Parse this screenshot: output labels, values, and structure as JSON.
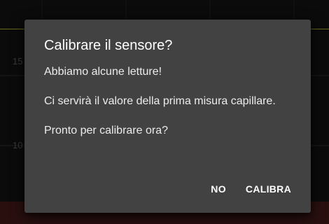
{
  "background": {
    "axis_labels": [
      "15",
      "10"
    ],
    "colors": {
      "background": "#0b0b0b",
      "target_line": "#6d6a1a",
      "low_band": "#2a0f0f"
    }
  },
  "dialog": {
    "title": "Calibrare il sensore?",
    "paragraphs": [
      "Abbiamo alcune letture!",
      "Ci servirà il valore della prima misura capillare.",
      "Pronto per calibrare ora?"
    ],
    "buttons": {
      "negative": "NO",
      "positive": "CALIBRA"
    },
    "colors": {
      "surface": "#424242",
      "text": "#ffffff"
    }
  }
}
